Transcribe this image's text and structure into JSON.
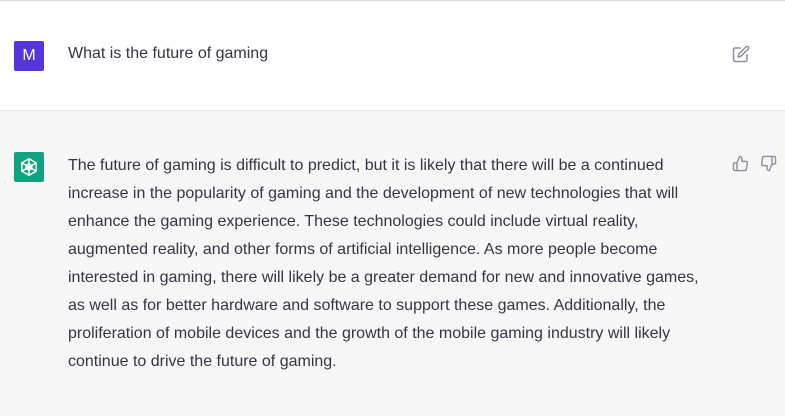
{
  "conversation": {
    "user_message": {
      "avatar_letter": "M",
      "avatar_color": "#5436da",
      "text": "What is the future of gaming",
      "edit_icon": "edit-icon"
    },
    "assistant_message": {
      "avatar_icon": "openai-logo-icon",
      "avatar_color": "#10a37f",
      "text": "The future of gaming is difficult to predict, but it is likely that there will be a continued increase in the popularity of gaming and the development of new technologies that will enhance the gaming experience. These technologies could include virtual reality, augmented reality, and other forms of artificial intelligence. As more people become interested in gaming, there will likely be a greater demand for new and innovative games, as well as for better hardware and software to support these games. Additionally, the proliferation of mobile devices and the growth of the mobile gaming industry will likely continue to drive the future of gaming.",
      "feedback_icons": [
        "thumbs-up-icon",
        "thumbs-down-icon"
      ]
    }
  },
  "colors": {
    "text": "#343541",
    "assistant_bg": "#f7f7f8",
    "icon": "#8e8ea0"
  }
}
